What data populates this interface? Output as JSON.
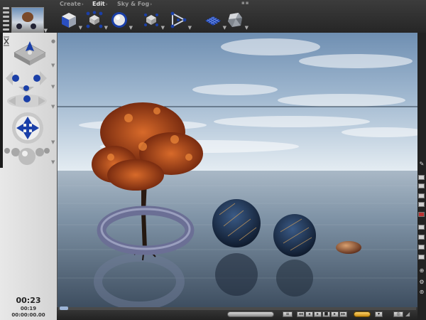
{
  "menu": {
    "items": [
      {
        "label": "Create",
        "active": false
      },
      {
        "label": "Edit",
        "active": true
      },
      {
        "label": "Sky & Fog",
        "active": false
      }
    ]
  },
  "toolbar": {
    "tools": [
      {
        "name": "cube-primitive-icon"
      },
      {
        "name": "move-object-icon"
      },
      {
        "name": "sphere-primitive-icon"
      },
      {
        "name": "select-object-icon"
      },
      {
        "name": "path-tool-icon"
      },
      {
        "name": "terrain-icon"
      },
      {
        "name": "rock-icon"
      }
    ]
  },
  "time": {
    "main": "00:23",
    "sub": "00:19",
    "frames": "00:00:00.00"
  },
  "colors": {
    "accent_blue": "#1a3fa8",
    "panel_bg": "#dcdcdc",
    "key_button": "#f0b030"
  }
}
